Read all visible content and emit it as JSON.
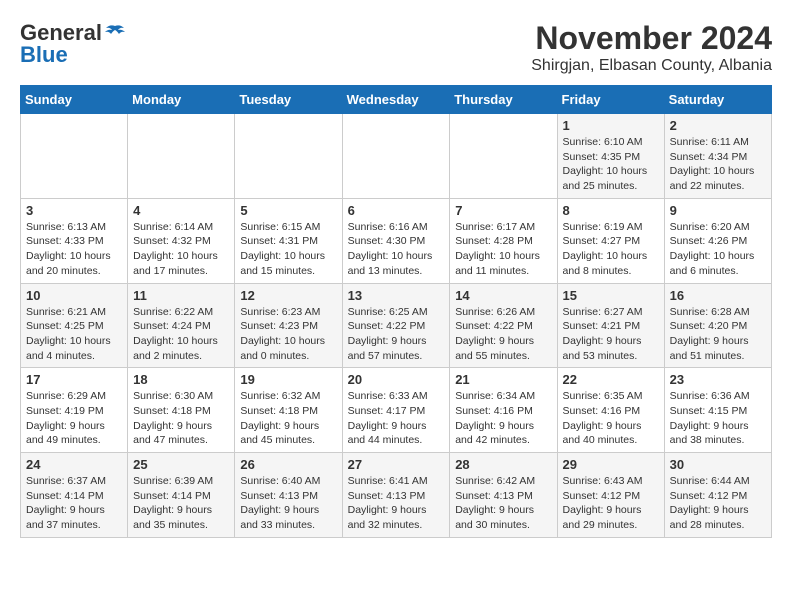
{
  "header": {
    "logo_general": "General",
    "logo_blue": "Blue",
    "month_title": "November 2024",
    "location": "Shirgjan, Elbasan County, Albania"
  },
  "weekdays": [
    "Sunday",
    "Monday",
    "Tuesday",
    "Wednesday",
    "Thursday",
    "Friday",
    "Saturday"
  ],
  "weeks": [
    [
      {
        "day": "",
        "info": ""
      },
      {
        "day": "",
        "info": ""
      },
      {
        "day": "",
        "info": ""
      },
      {
        "day": "",
        "info": ""
      },
      {
        "day": "",
        "info": ""
      },
      {
        "day": "1",
        "info": "Sunrise: 6:10 AM\nSunset: 4:35 PM\nDaylight: 10 hours and 25 minutes."
      },
      {
        "day": "2",
        "info": "Sunrise: 6:11 AM\nSunset: 4:34 PM\nDaylight: 10 hours and 22 minutes."
      }
    ],
    [
      {
        "day": "3",
        "info": "Sunrise: 6:13 AM\nSunset: 4:33 PM\nDaylight: 10 hours and 20 minutes."
      },
      {
        "day": "4",
        "info": "Sunrise: 6:14 AM\nSunset: 4:32 PM\nDaylight: 10 hours and 17 minutes."
      },
      {
        "day": "5",
        "info": "Sunrise: 6:15 AM\nSunset: 4:31 PM\nDaylight: 10 hours and 15 minutes."
      },
      {
        "day": "6",
        "info": "Sunrise: 6:16 AM\nSunset: 4:30 PM\nDaylight: 10 hours and 13 minutes."
      },
      {
        "day": "7",
        "info": "Sunrise: 6:17 AM\nSunset: 4:28 PM\nDaylight: 10 hours and 11 minutes."
      },
      {
        "day": "8",
        "info": "Sunrise: 6:19 AM\nSunset: 4:27 PM\nDaylight: 10 hours and 8 minutes."
      },
      {
        "day": "9",
        "info": "Sunrise: 6:20 AM\nSunset: 4:26 PM\nDaylight: 10 hours and 6 minutes."
      }
    ],
    [
      {
        "day": "10",
        "info": "Sunrise: 6:21 AM\nSunset: 4:25 PM\nDaylight: 10 hours and 4 minutes."
      },
      {
        "day": "11",
        "info": "Sunrise: 6:22 AM\nSunset: 4:24 PM\nDaylight: 10 hours and 2 minutes."
      },
      {
        "day": "12",
        "info": "Sunrise: 6:23 AM\nSunset: 4:23 PM\nDaylight: 10 hours and 0 minutes."
      },
      {
        "day": "13",
        "info": "Sunrise: 6:25 AM\nSunset: 4:22 PM\nDaylight: 9 hours and 57 minutes."
      },
      {
        "day": "14",
        "info": "Sunrise: 6:26 AM\nSunset: 4:22 PM\nDaylight: 9 hours and 55 minutes."
      },
      {
        "day": "15",
        "info": "Sunrise: 6:27 AM\nSunset: 4:21 PM\nDaylight: 9 hours and 53 minutes."
      },
      {
        "day": "16",
        "info": "Sunrise: 6:28 AM\nSunset: 4:20 PM\nDaylight: 9 hours and 51 minutes."
      }
    ],
    [
      {
        "day": "17",
        "info": "Sunrise: 6:29 AM\nSunset: 4:19 PM\nDaylight: 9 hours and 49 minutes."
      },
      {
        "day": "18",
        "info": "Sunrise: 6:30 AM\nSunset: 4:18 PM\nDaylight: 9 hours and 47 minutes."
      },
      {
        "day": "19",
        "info": "Sunrise: 6:32 AM\nSunset: 4:18 PM\nDaylight: 9 hours and 45 minutes."
      },
      {
        "day": "20",
        "info": "Sunrise: 6:33 AM\nSunset: 4:17 PM\nDaylight: 9 hours and 44 minutes."
      },
      {
        "day": "21",
        "info": "Sunrise: 6:34 AM\nSunset: 4:16 PM\nDaylight: 9 hours and 42 minutes."
      },
      {
        "day": "22",
        "info": "Sunrise: 6:35 AM\nSunset: 4:16 PM\nDaylight: 9 hours and 40 minutes."
      },
      {
        "day": "23",
        "info": "Sunrise: 6:36 AM\nSunset: 4:15 PM\nDaylight: 9 hours and 38 minutes."
      }
    ],
    [
      {
        "day": "24",
        "info": "Sunrise: 6:37 AM\nSunset: 4:14 PM\nDaylight: 9 hours and 37 minutes."
      },
      {
        "day": "25",
        "info": "Sunrise: 6:39 AM\nSunset: 4:14 PM\nDaylight: 9 hours and 35 minutes."
      },
      {
        "day": "26",
        "info": "Sunrise: 6:40 AM\nSunset: 4:13 PM\nDaylight: 9 hours and 33 minutes."
      },
      {
        "day": "27",
        "info": "Sunrise: 6:41 AM\nSunset: 4:13 PM\nDaylight: 9 hours and 32 minutes."
      },
      {
        "day": "28",
        "info": "Sunrise: 6:42 AM\nSunset: 4:13 PM\nDaylight: 9 hours and 30 minutes."
      },
      {
        "day": "29",
        "info": "Sunrise: 6:43 AM\nSunset: 4:12 PM\nDaylight: 9 hours and 29 minutes."
      },
      {
        "day": "30",
        "info": "Sunrise: 6:44 AM\nSunset: 4:12 PM\nDaylight: 9 hours and 28 minutes."
      }
    ]
  ]
}
